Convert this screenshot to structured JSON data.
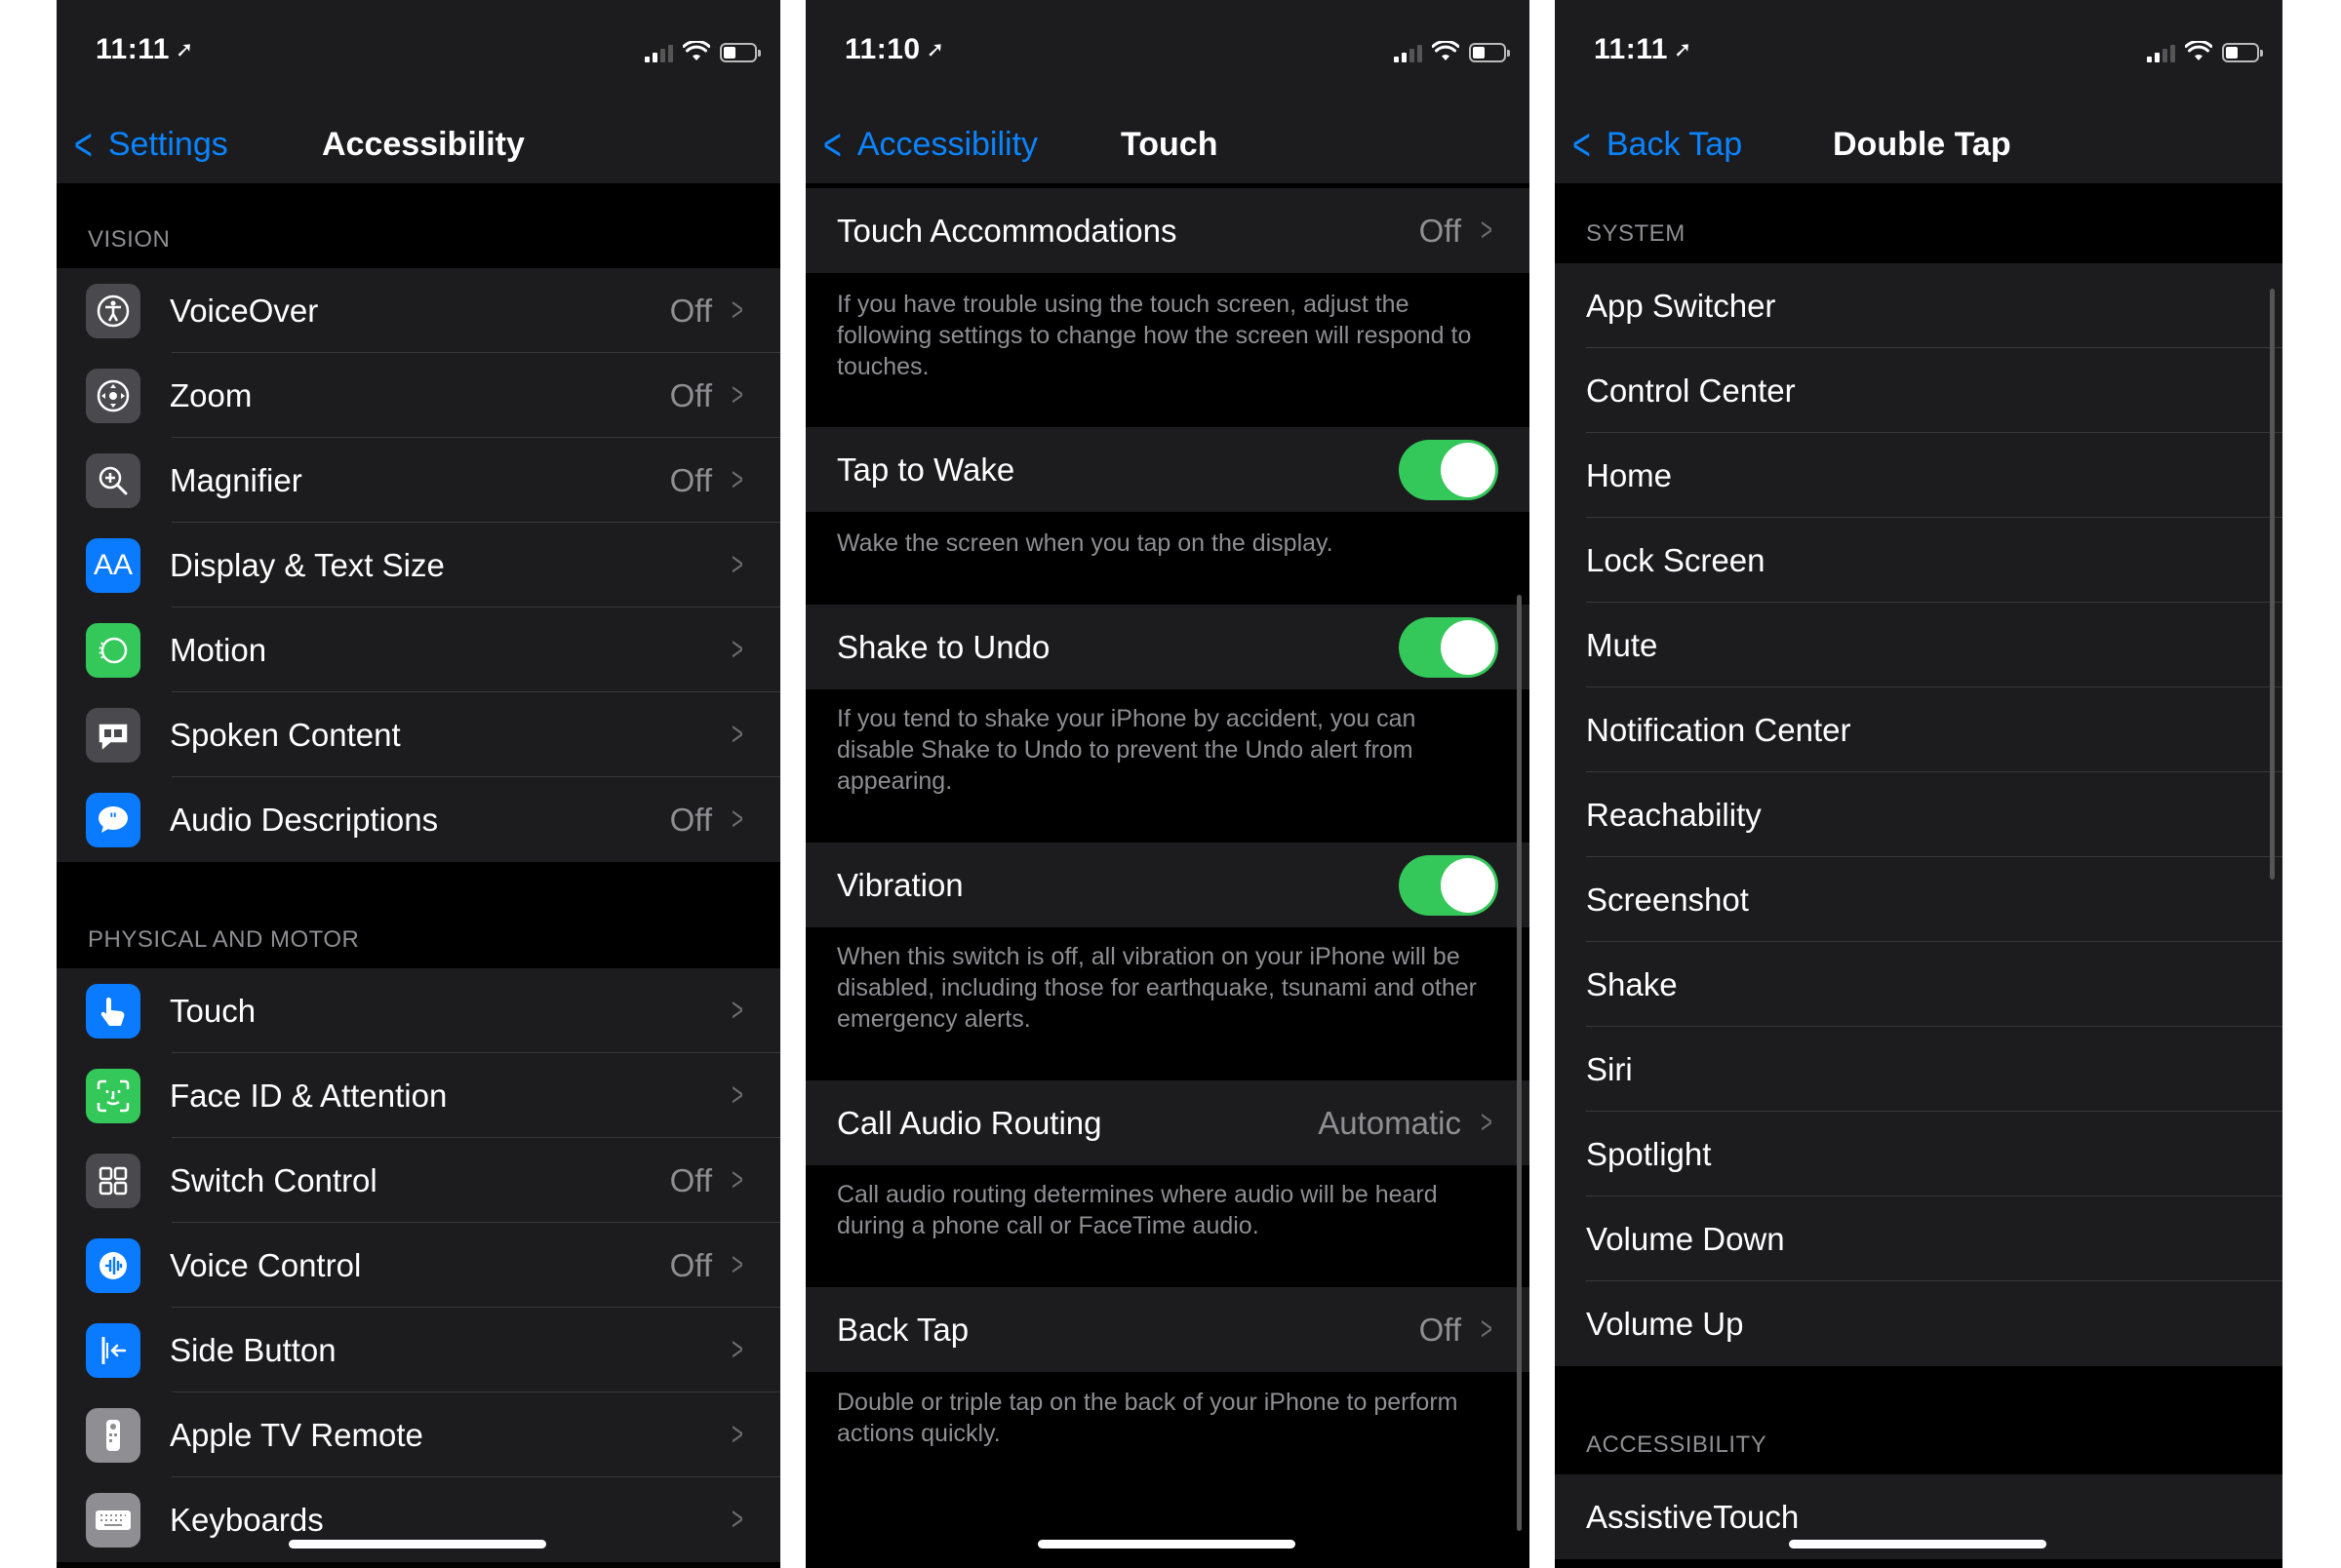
{
  "screens": [
    {
      "status": {
        "time": "11:11"
      },
      "nav": {
        "back": "Settings",
        "title": "Accessibility"
      },
      "sections": [
        {
          "header": "VISION",
          "items": [
            {
              "label": "VoiceOver",
              "value": "Off",
              "icon": "voiceover-icon"
            },
            {
              "label": "Zoom",
              "value": "Off",
              "icon": "zoom-icon"
            },
            {
              "label": "Magnifier",
              "value": "Off",
              "icon": "magnifier-icon"
            },
            {
              "label": "Display & Text Size",
              "value": "",
              "icon": "text-size-icon",
              "glyph": "AA"
            },
            {
              "label": "Motion",
              "value": "",
              "icon": "motion-icon"
            },
            {
              "label": "Spoken Content",
              "value": "",
              "icon": "spoken-content-icon"
            },
            {
              "label": "Audio Descriptions",
              "value": "Off",
              "icon": "audio-descriptions-icon"
            }
          ]
        },
        {
          "header": "PHYSICAL AND MOTOR",
          "items": [
            {
              "label": "Touch",
              "value": "",
              "icon": "touch-hand-icon"
            },
            {
              "label": "Face ID & Attention",
              "value": "",
              "icon": "face-id-icon"
            },
            {
              "label": "Switch Control",
              "value": "Off",
              "icon": "switch-control-icon"
            },
            {
              "label": "Voice Control",
              "value": "Off",
              "icon": "voice-control-icon"
            },
            {
              "label": "Side Button",
              "value": "",
              "icon": "side-button-icon"
            },
            {
              "label": "Apple TV Remote",
              "value": "",
              "icon": "tv-remote-icon"
            },
            {
              "label": "Keyboards",
              "value": "",
              "icon": "keyboard-icon"
            }
          ]
        }
      ]
    },
    {
      "status": {
        "time": "11:10"
      },
      "nav": {
        "back": "Accessibility",
        "title": "Touch"
      },
      "groups": [
        {
          "label": "Touch Accommodations",
          "value": "Off",
          "footer": "If you have trouble using the touch screen, adjust the following settings to change how the screen will respond to touches."
        },
        {
          "label": "Tap to Wake",
          "toggle": true,
          "footer": "Wake the screen when you tap on the display."
        },
        {
          "label": "Shake to Undo",
          "toggle": true,
          "footer": "If you tend to shake your iPhone by accident, you can disable Shake to Undo to prevent the Undo alert from appearing."
        },
        {
          "label": "Vibration",
          "toggle": true,
          "footer": "When this switch is off, all vibration on your iPhone will be disabled, including those for earthquake, tsunami and other emergency alerts."
        },
        {
          "label": "Call Audio Routing",
          "value": "Automatic",
          "footer": "Call audio routing determines where audio will be heard during a phone call or FaceTime audio."
        },
        {
          "label": "Back Tap",
          "value": "Off",
          "footer": "Double or triple tap on the back of your iPhone to perform actions quickly."
        }
      ]
    },
    {
      "status": {
        "time": "11:11"
      },
      "nav": {
        "back": "Back Tap",
        "title": "Double Tap"
      },
      "sections": [
        {
          "header": "SYSTEM",
          "items": [
            "App Switcher",
            "Control Center",
            "Home",
            "Lock Screen",
            "Mute",
            "Notification Center",
            "Reachability",
            "Screenshot",
            "Shake",
            "Siri",
            "Spotlight",
            "Volume Down",
            "Volume Up"
          ]
        },
        {
          "header": "ACCESSIBILITY",
          "items": [
            "AssistiveTouch"
          ]
        }
      ]
    }
  ],
  "colors": {
    "accent": "#0a84ff",
    "toggle_on": "#34c759",
    "cell_bg": "#1c1c1e",
    "secondary_text": "#8e8e93"
  }
}
